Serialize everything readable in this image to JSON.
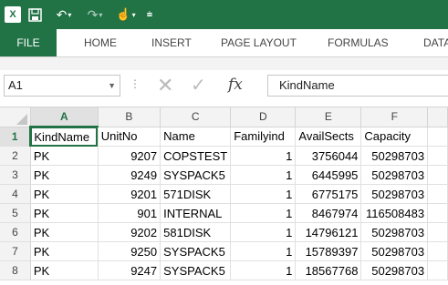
{
  "quick_access": {
    "excel_icon_label": "X",
    "save_icon": "save-icon",
    "undo_icon": "undo-icon",
    "redo_icon": "redo-icon",
    "touch_icon": "touch-mode-icon",
    "customize_icon": "customize-icon"
  },
  "ribbon": {
    "tabs": [
      "FILE",
      "HOME",
      "INSERT",
      "PAGE LAYOUT",
      "FORMULAS",
      "DATA"
    ]
  },
  "formula_bar": {
    "name_box": "A1",
    "content": "KindName"
  },
  "sheet": {
    "columns": [
      "A",
      "B",
      "C",
      "D",
      "E",
      "F"
    ],
    "rows": [
      [
        "1",
        "KindName",
        "UnitNo",
        "Name",
        "Familyind",
        "AvailSects",
        "Capacity"
      ],
      [
        "2",
        "PK",
        "9207",
        "COPSTEST",
        "1",
        "3756044",
        "50298703"
      ],
      [
        "3",
        "PK",
        "9249",
        "SYSPACK5",
        "1",
        "6445995",
        "50298703"
      ],
      [
        "4",
        "PK",
        "9201",
        "571DISK",
        "1",
        "6775175",
        "50298703"
      ],
      [
        "5",
        "PK",
        "901",
        "INTERNAL",
        "1",
        "8467974",
        "116508483"
      ],
      [
        "6",
        "PK",
        "9202",
        "581DISK",
        "1",
        "14796121",
        "50298703"
      ],
      [
        "7",
        "PK",
        "9250",
        "SYSPACK5",
        "1",
        "15789397",
        "50298703"
      ],
      [
        "8",
        "PK",
        "9247",
        "SYSPACK5",
        "1",
        "18567768",
        "50298703"
      ]
    ]
  },
  "colors": {
    "accent": "#217346",
    "window_frame": "#6b3f8f"
  }
}
